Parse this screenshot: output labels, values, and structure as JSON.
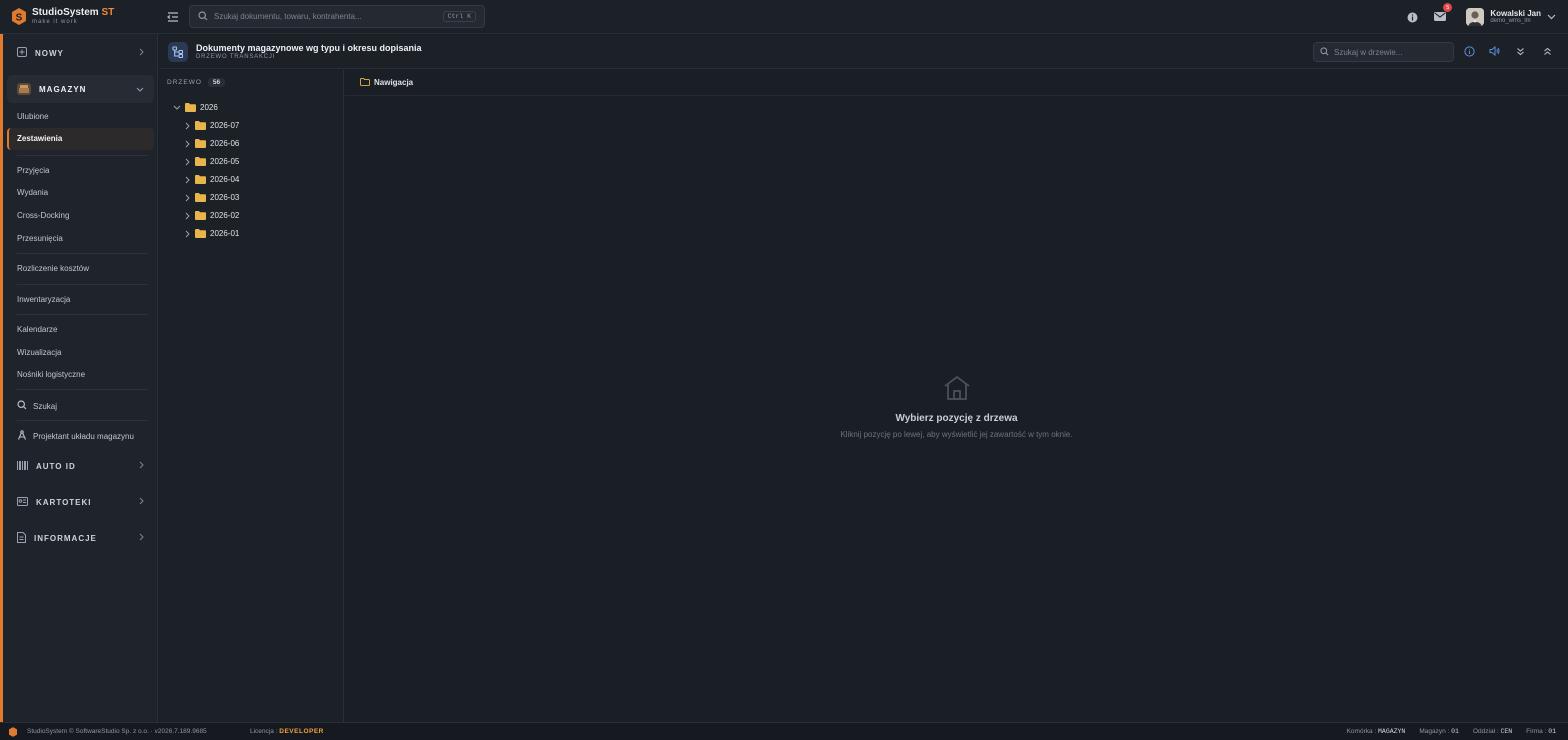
{
  "brand": {
    "name": "StudioSystem",
    "suffix": "ST",
    "tagline": "make it work"
  },
  "search": {
    "placeholder": "Szukaj dokumentu, towaru, kontrahenta...",
    "shortcut": "Ctrl K"
  },
  "notifications": {
    "count": "5"
  },
  "user": {
    "name": "Kowalski Jan",
    "login": "demo_wms_lm"
  },
  "sidebar": {
    "nowy": "NOWY",
    "magazyn": "MAGAZYN",
    "items": {
      "ulubione": "Ulubione",
      "zestawienia": "Zestawienia",
      "przyjecia": "Przyjęcia",
      "wydania": "Wydania",
      "crossdocking": "Cross-Docking",
      "przesuniecia": "Przesunięcia",
      "rozliczenie": "Rozliczenie kosztów",
      "inwentaryzacja": "Inwentaryzacja",
      "kalendarze": "Kalendarze",
      "wizualizacja": "Wizualizacja",
      "nosniki": "Nośniki logistyczne",
      "szukaj": "Szukaj",
      "projektant": "Projektant układu magazynu"
    },
    "autoid": "AUTO ID",
    "kartoteki": "KARTOTEKI",
    "informacje": "INFORMACJE"
  },
  "page": {
    "title": "Dokumenty magazynowe wg typu i okresu dopisania",
    "subtitle": "DRZEWO TRANSAKCJI",
    "tree_search_placeholder": "Szukaj w drzewie..."
  },
  "tree": {
    "label": "DRZEWO",
    "count": "56",
    "root": "2026",
    "children": [
      "2026-07",
      "2026-06",
      "2026-05",
      "2026-04",
      "2026-03",
      "2026-02",
      "2026-01"
    ]
  },
  "content": {
    "breadcrumb": "Nawigacja",
    "empty_title": "Wybierz pozycję z drzewa",
    "empty_desc": "Kliknij pozycję po lewej, aby wyświetlić jej zawartość w tym oknie."
  },
  "footer": {
    "copyright": "StudioSystem © SoftwareStudio Sp. z o.o. · v2026.7.189.9685",
    "license_label": "Licencja :",
    "license_value": "DEVELOPER",
    "komorka_label": "Komórka :",
    "komorka_value": "MAGAZYN",
    "magazyn_label": "Magazyn :",
    "magazyn_value": "01",
    "oddzial_label": "Oddział :",
    "oddzial_value": "CEN",
    "firma_label": "Firma :",
    "firma_value": "01"
  },
  "colors": {
    "accent": "#e07a2e",
    "folder": "#e8b54a",
    "license": "#f0a23c"
  }
}
